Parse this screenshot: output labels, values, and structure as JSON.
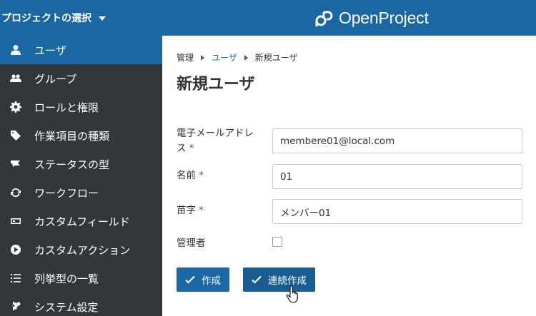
{
  "header": {
    "project_select_label": "プロジェクトの選択",
    "logo_text": "OpenProject"
  },
  "sidebar": {
    "items": [
      {
        "label": "ユーザ",
        "icon": "user-icon",
        "active": true
      },
      {
        "label": "グループ",
        "icon": "group-icon",
        "active": false
      },
      {
        "label": "ロールと権限",
        "icon": "gear-icon",
        "active": false
      },
      {
        "label": "作業項目の種類",
        "icon": "tag-icon",
        "active": false
      },
      {
        "label": "ステータスの型",
        "icon": "flag-icon",
        "active": false
      },
      {
        "label": "ワークフロー",
        "icon": "cycle-icon",
        "active": false
      },
      {
        "label": "カスタムフィールド",
        "icon": "custom-field-icon",
        "active": false
      },
      {
        "label": "カスタムアクション",
        "icon": "play-icon",
        "active": false
      },
      {
        "label": "列挙型の一覧",
        "icon": "list-icon",
        "active": false
      },
      {
        "label": "システム設定",
        "icon": "settings-icon",
        "active": false
      }
    ]
  },
  "breadcrumb": {
    "root": "管理",
    "parent": "ユーザ",
    "current": "新規ユーザ"
  },
  "page": {
    "title": "新規ユーザ"
  },
  "form": {
    "email_label_line1": "電子メールアドレ",
    "email_label_line2": "ス",
    "email_value": "membere01@local.com",
    "name_label": "名前",
    "name_value": "01",
    "surname_label": "苗字",
    "surname_value": "メンバー01",
    "admin_label": "管理者",
    "required_mark": "*"
  },
  "buttons": {
    "create_label": "作成",
    "create_continue_label": "連続作成"
  },
  "colors": {
    "header": "#1a67a3",
    "sidebar": "#333739",
    "active_item": "#1a67a3",
    "button": "#1a67a3"
  }
}
